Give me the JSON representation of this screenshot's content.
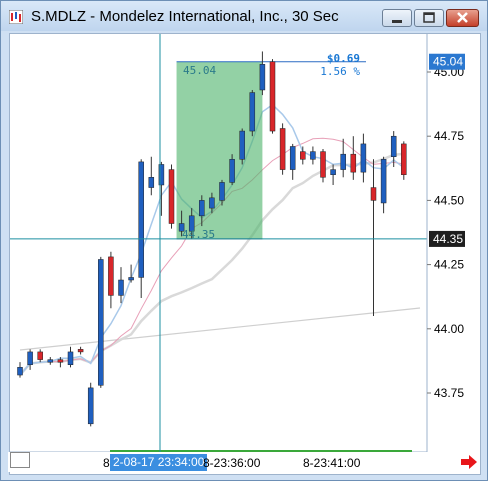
{
  "window": {
    "title": "S.MDLZ - Mondelez International, Inc., 30 Sec",
    "buttons": [
      "minimize",
      "maximize",
      "close"
    ]
  },
  "chart_data": {
    "type": "candlestick",
    "symbol": "S.MDLZ",
    "interval": "30 Sec",
    "ylim": [
      43.6,
      45.14
    ],
    "y_ticks": [
      "45.00",
      "44.75",
      "44.50",
      "44.25",
      "44.00",
      "43.75"
    ],
    "x_labels": [
      "8",
      "8-23:36:00",
      "8-23:41:00"
    ],
    "cursor_time": "2-08-17 23:34:00",
    "cursor_price": "44.35",
    "last_price": "45.04",
    "measure": {
      "change": "$0.69",
      "percent": "1.56 %",
      "start_label": "44.35",
      "end_label": "45.04"
    },
    "candles": [
      {
        "o": 43.85,
        "h": 43.87,
        "l": 43.81,
        "c": 43.82,
        "color": "#1f5fbf"
      },
      {
        "o": 43.86,
        "h": 43.92,
        "l": 43.84,
        "c": 43.91,
        "color": "#1f5fbf"
      },
      {
        "o": 43.91,
        "h": 43.92,
        "l": 43.87,
        "c": 43.88,
        "color": "#d8262a"
      },
      {
        "o": 43.87,
        "h": 43.89,
        "l": 43.86,
        "c": 43.88,
        "color": "#1f5fbf"
      },
      {
        "o": 43.88,
        "h": 43.89,
        "l": 43.85,
        "c": 43.87,
        "color": "#d8262a"
      },
      {
        "o": 43.86,
        "h": 43.93,
        "l": 43.85,
        "c": 43.91,
        "color": "#1f5fbf"
      },
      {
        "o": 43.92,
        "h": 43.93,
        "l": 43.9,
        "c": 43.91,
        "color": "#d8262a"
      },
      {
        "o": 43.63,
        "h": 43.79,
        "l": 43.62,
        "c": 43.77,
        "color": "#1f5fbf"
      },
      {
        "o": 43.78,
        "h": 44.28,
        "l": 43.77,
        "c": 44.27,
        "color": "#1f5fbf"
      },
      {
        "o": 44.28,
        "h": 44.3,
        "l": 44.08,
        "c": 44.13,
        "color": "#d8262a"
      },
      {
        "o": 44.13,
        "h": 44.24,
        "l": 44.1,
        "c": 44.19,
        "color": "#1f5fbf"
      },
      {
        "o": 44.19,
        "h": 44.25,
        "l": 44.18,
        "c": 44.2,
        "color": "#1f5fbf"
      },
      {
        "o": 44.2,
        "h": 44.66,
        "l": 44.12,
        "c": 44.65,
        "color": "#1f5fbf"
      },
      {
        "o": 44.55,
        "h": 44.67,
        "l": 44.52,
        "c": 44.59,
        "color": "#1f5fbf"
      },
      {
        "o": 44.56,
        "h": 44.65,
        "l": 44.44,
        "c": 44.64,
        "color": "#1f5fbf"
      },
      {
        "o": 44.62,
        "h": 44.64,
        "l": 44.39,
        "c": 44.41,
        "color": "#d8262a"
      },
      {
        "o": 44.41,
        "h": 44.46,
        "l": 44.36,
        "c": 44.38,
        "color": "#1f5fbf"
      },
      {
        "o": 44.38,
        "h": 44.47,
        "l": 44.35,
        "c": 44.44,
        "color": "#1f5fbf"
      },
      {
        "o": 44.44,
        "h": 44.52,
        "l": 44.4,
        "c": 44.5,
        "color": "#1f5fbf"
      },
      {
        "o": 44.47,
        "h": 44.53,
        "l": 44.45,
        "c": 44.51,
        "color": "#1f5fbf"
      },
      {
        "o": 44.5,
        "h": 44.58,
        "l": 44.48,
        "c": 44.57,
        "color": "#1f5fbf"
      },
      {
        "o": 44.57,
        "h": 44.68,
        "l": 44.56,
        "c": 44.66,
        "color": "#1f5fbf"
      },
      {
        "o": 44.66,
        "h": 44.78,
        "l": 44.64,
        "c": 44.77,
        "color": "#1f5fbf"
      },
      {
        "o": 44.77,
        "h": 44.93,
        "l": 44.75,
        "c": 44.92,
        "color": "#1f5fbf"
      },
      {
        "o": 44.93,
        "h": 45.08,
        "l": 44.91,
        "c": 45.03,
        "color": "#1f5fbf"
      },
      {
        "o": 45.04,
        "h": 45.05,
        "l": 44.76,
        "c": 44.77,
        "color": "#d8262a"
      },
      {
        "o": 44.78,
        "h": 44.8,
        "l": 44.6,
        "c": 44.62,
        "color": "#d8262a"
      },
      {
        "o": 44.62,
        "h": 44.72,
        "l": 44.58,
        "c": 44.71,
        "color": "#1f5fbf"
      },
      {
        "o": 44.69,
        "h": 44.71,
        "l": 44.64,
        "c": 44.66,
        "color": "#d8262a"
      },
      {
        "o": 44.66,
        "h": 44.71,
        "l": 44.64,
        "c": 44.69,
        "color": "#1f5fbf"
      },
      {
        "o": 44.69,
        "h": 44.7,
        "l": 44.57,
        "c": 44.59,
        "color": "#d8262a"
      },
      {
        "o": 44.6,
        "h": 44.64,
        "l": 44.56,
        "c": 44.62,
        "color": "#1f5fbf"
      },
      {
        "o": 44.62,
        "h": 44.74,
        "l": 44.59,
        "c": 44.68,
        "color": "#1f5fbf"
      },
      {
        "o": 44.68,
        "h": 44.75,
        "l": 44.58,
        "c": 44.61,
        "color": "#d8262a"
      },
      {
        "o": 44.61,
        "h": 44.76,
        "l": 44.57,
        "c": 44.72,
        "color": "#1f5fbf"
      },
      {
        "o": 44.55,
        "h": 44.66,
        "l": 44.05,
        "c": 44.5,
        "color": "#d8262a"
      },
      {
        "o": 44.49,
        "h": 44.67,
        "l": 44.45,
        "c": 44.66,
        "color": "#1f5fbf"
      },
      {
        "o": 44.67,
        "h": 44.77,
        "l": 44.63,
        "c": 44.75,
        "color": "#1f5fbf"
      },
      {
        "o": 44.72,
        "h": 44.73,
        "l": 44.58,
        "c": 44.6,
        "color": "#d8262a"
      }
    ]
  }
}
